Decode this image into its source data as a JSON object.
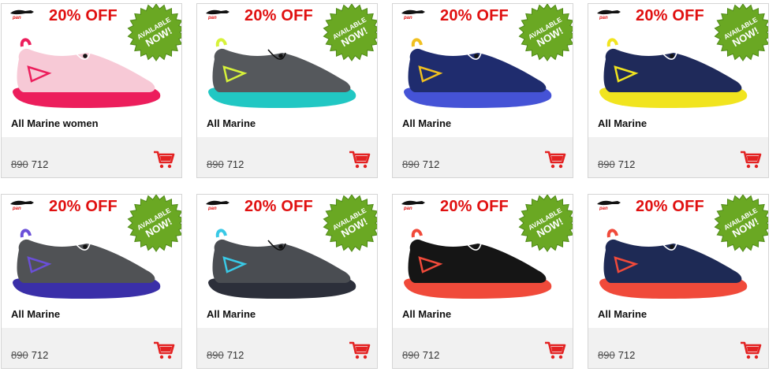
{
  "products": [
    {
      "name": "All Marine women",
      "offer": "20% OFF",
      "badge_line1": "AVAILABLE",
      "badge_line2": "NOW!",
      "old_price": "890",
      "new_price": "712",
      "colors": {
        "upper": "#f7c9d6",
        "sole": "#ec1e5c",
        "accent": "#ec1e5c",
        "lace": "#ffffff"
      }
    },
    {
      "name": "All Marine",
      "offer": "20% OFF",
      "badge_line1": "AVAILABLE",
      "badge_line2": "NOW!",
      "old_price": "890",
      "new_price": "712",
      "colors": {
        "upper": "#55585c",
        "sole": "#21c7c3",
        "accent": "#d7f23a",
        "lace": "#111111"
      }
    },
    {
      "name": "All Marine",
      "offer": "20% OFF",
      "badge_line1": "AVAILABLE",
      "badge_line2": "NOW!",
      "old_price": "890",
      "new_price": "712",
      "colors": {
        "upper": "#1f2c6e",
        "sole": "#4553d6",
        "accent": "#f0c020",
        "lace": "#ffffff"
      }
    },
    {
      "name": "All Marine",
      "offer": "20% OFF",
      "badge_line1": "AVAILABLE",
      "badge_line2": "NOW!",
      "old_price": "890",
      "new_price": "712",
      "colors": {
        "upper": "#1f2a5a",
        "sole": "#f1e41f",
        "accent": "#f1e41f",
        "lace": "#ffffff"
      }
    },
    {
      "name": "All Marine",
      "offer": "20% OFF",
      "badge_line1": "AVAILABLE",
      "badge_line2": "NOW!",
      "old_price": "890",
      "new_price": "712",
      "colors": {
        "upper": "#505255",
        "sole": "#3a2fa8",
        "accent": "#6a4fd8",
        "lace": "#ffffff"
      }
    },
    {
      "name": "All Marine",
      "offer": "20% OFF",
      "badge_line1": "AVAILABLE",
      "badge_line2": "NOW!",
      "old_price": "890",
      "new_price": "712",
      "colors": {
        "upper": "#4a4d52",
        "sole": "#2c2f3a",
        "accent": "#39c9e6",
        "lace": "#111111"
      }
    },
    {
      "name": "All Marine",
      "offer": "20% OFF",
      "badge_line1": "AVAILABLE",
      "badge_line2": "NOW!",
      "old_price": "890",
      "new_price": "712",
      "colors": {
        "upper": "#151515",
        "sole": "#f04a3a",
        "accent": "#f04a3a",
        "lace": "#ffffff"
      }
    },
    {
      "name": "All Marine",
      "offer": "20% OFF",
      "badge_line1": "AVAILABLE",
      "badge_line2": "NOW!",
      "old_price": "890",
      "new_price": "712",
      "colors": {
        "upper": "#1e2a55",
        "sole": "#f04a3a",
        "accent": "#f04a3a",
        "lace": "#ffffff"
      }
    }
  ],
  "brand_name": "pan",
  "theme": {
    "offer_red": "#e01010",
    "badge_green": "#6aa823",
    "cart_red": "#e32222"
  },
  "icons": {
    "brand": "panther-logo-icon",
    "badge": "starburst-badge-icon",
    "cart": "shopping-cart-icon"
  }
}
